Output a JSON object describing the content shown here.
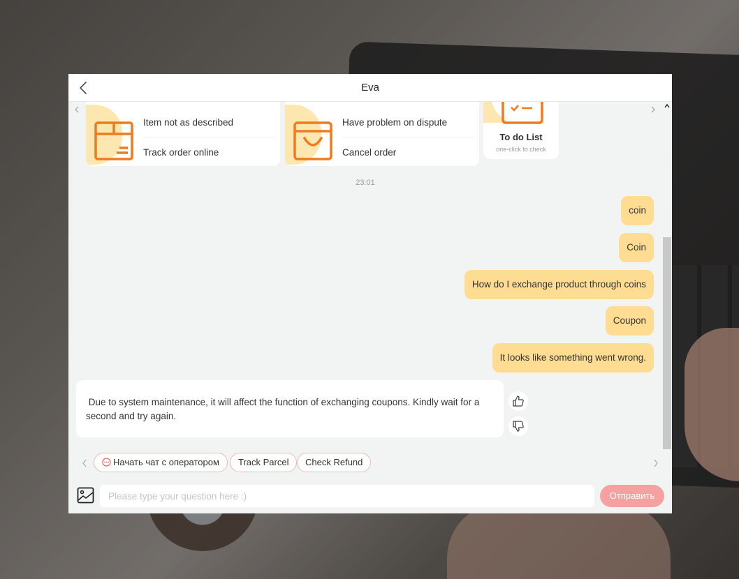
{
  "header": {
    "title": "Eva"
  },
  "cards": {
    "card1": {
      "row1": "Item not as described",
      "row2": "Track order online"
    },
    "card2": {
      "row1": "Have problem on dispute",
      "row2": "Cancel order"
    },
    "todo": {
      "title": "To do List",
      "subtitle": "one-click to check"
    }
  },
  "timestamp": "23:01",
  "messages": {
    "user": [
      "coin",
      "Coin",
      "How do I exchange product through coins",
      "Coupon",
      "It looks like something went wrong."
    ],
    "bot": " Due to system maintenance, it will affect the function of exchanging coupons. Kindly wait for a second and try again."
  },
  "quick_replies": {
    "operator": "Начать чат с оператором",
    "track": "Track Parcel",
    "refund": "Check Refund"
  },
  "composer": {
    "placeholder": "Please type your question here :)",
    "send_label": "Отправить"
  },
  "colors": {
    "user_bubble": "#fedc92",
    "accent_orange": "#f07b1f",
    "send_button": "#f6a1a1",
    "chip_border": "#f3b9b6"
  }
}
